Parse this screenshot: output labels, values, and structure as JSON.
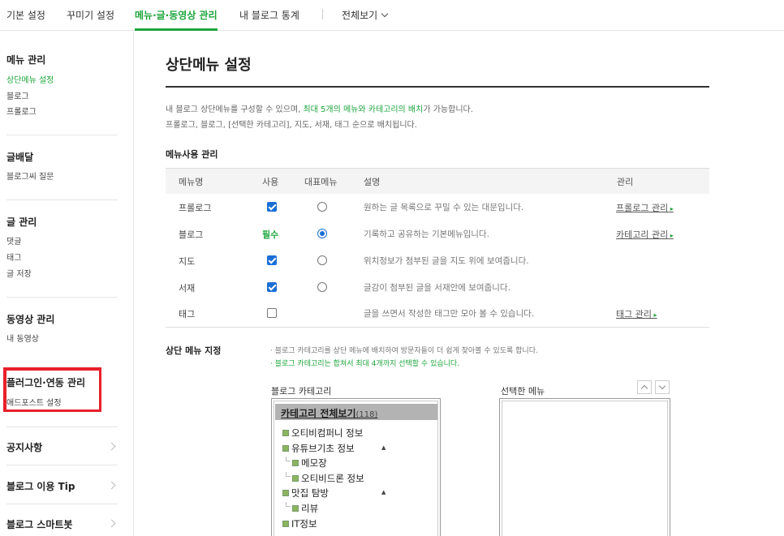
{
  "topnav": {
    "tabs": [
      "기본 설정",
      "꾸미기 설정",
      "메뉴·글·동영상 관리",
      "내 블로그 통계",
      "전체보기"
    ],
    "active_index": 2
  },
  "sidebar": {
    "menu_mgmt": {
      "title": "메뉴 관리",
      "items": [
        "상단메뉴 설정",
        "블로그",
        "프롤로그"
      ]
    },
    "post_delivery": {
      "title": "글배달",
      "items": [
        "블로그씨 질문"
      ]
    },
    "post_mgmt": {
      "title": "글 관리",
      "items": [
        "댓글",
        "태그",
        "글 저장"
      ]
    },
    "video_mgmt": {
      "title": "동영상 관리",
      "items": [
        "내 동영상"
      ]
    },
    "plugin": {
      "title": "플러그인·연동 관리",
      "items": [
        "애드포스트 설정"
      ]
    },
    "links": [
      "공지사항",
      "블로그 이용 Tip",
      "블로그 스마트봇"
    ]
  },
  "main": {
    "title": "상단메뉴 설정",
    "desc_line1_a": "내 블로그 상단메뉴를 구성할 수 있으며, ",
    "desc_line1_b": "최대 5개의 메뉴와 카테고리의 배치",
    "desc_line1_c": "가 가능합니다.",
    "desc_line2": "프롤로그, 블로그, [선택한 카테고리], 지도, 서재, 태그 순으로 배치됩니다.",
    "usage_title": "메뉴사용 관리",
    "table": {
      "headers": [
        "메뉴명",
        "사용",
        "대표메뉴",
        "설명",
        "관리"
      ],
      "rows": [
        {
          "name": "프롤로그",
          "use": "checked",
          "rep": false,
          "desc": "원하는 글 목록으로 꾸밀 수 있는 대문입니다.",
          "manage": "프롤로그 관리"
        },
        {
          "name": "블로그",
          "use": "필수",
          "rep": true,
          "desc": "기록하고 공유하는 기본메뉴입니다.",
          "manage": "카테고리 관리"
        },
        {
          "name": "지도",
          "use": "checked",
          "rep": false,
          "desc": "위치정보가 첨부된 글을 지도 위에 보여줍니다.",
          "manage": ""
        },
        {
          "name": "서재",
          "use": "checked",
          "rep": false,
          "desc": "글감이 첨부된 글을 서재안에 보여줍니다.",
          "manage": ""
        },
        {
          "name": "태그",
          "use": "unchecked",
          "rep": null,
          "desc": "글을 쓰면서 작성한 태그만 모아 볼 수 있습니다.",
          "manage": "태그 관리"
        }
      ]
    },
    "top_menu": {
      "title": "상단 메뉴 지정",
      "note1": "· 블로그 카테고리를 상단 메뉴에 배치하여 방문자들이 더 쉽게 찾아볼 수 있도록 합니다.",
      "note2": "· 블로그 카테고리는 합쳐서 최대 4개까지 선택할 수 있습니다.",
      "left_label": "블로그 카테고리",
      "right_label": "선택한 메뉴",
      "tree_header": "카테고리 전체보기",
      "tree_count": "(118)",
      "tree": [
        "오티비컴퍼니 정보",
        "유튜브기초 정보",
        "메모장",
        "오티비드론 정보",
        "맛집 탐방",
        "리뷰",
        "IT정보"
      ]
    }
  }
}
